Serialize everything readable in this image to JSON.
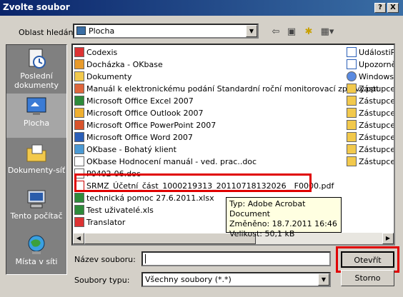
{
  "window": {
    "title": "Zvolte soubor",
    "help_label": "?",
    "close_label": "X"
  },
  "lookin": {
    "label": "Oblast hledání:",
    "value": "Plocha"
  },
  "toolbar_icons": [
    "back-icon",
    "up-folder-icon",
    "new-folder-icon",
    "view-menu-icon"
  ],
  "places": [
    {
      "label": "Poslední dokumenty",
      "icon": "recent-documents-icon"
    },
    {
      "label": "Plocha",
      "icon": "desktop-icon"
    },
    {
      "label": "Dokumenty-síť",
      "icon": "documents-network-icon"
    },
    {
      "label": "Tento počítač",
      "icon": "my-computer-icon"
    },
    {
      "label": "Místa v síti",
      "icon": "network-places-icon"
    }
  ],
  "files_col1": [
    {
      "name": "Codexis",
      "icon": "shortcut-icon"
    },
    {
      "name": "Docházka - OKbase",
      "icon": "web-shortcut-icon"
    },
    {
      "name": "Dokumenty",
      "icon": "folder-icon"
    },
    {
      "name": "Manuál k elektronickému podání Standardní roční monitorovací zprávy.ppt",
      "icon": "ppt-icon"
    },
    {
      "name": "Microsoft Office Excel 2007",
      "icon": "excel-icon"
    },
    {
      "name": "Microsoft Office Outlook 2007",
      "icon": "outlook-icon"
    },
    {
      "name": "Microsoft Office PowerPoint 2007",
      "icon": "powerpoint-icon"
    },
    {
      "name": "Microsoft Office Word 2007",
      "icon": "word-icon"
    },
    {
      "name": "OKbase - Bohatý klient",
      "icon": "app-icon"
    },
    {
      "name": "OKbase Hodnocení manuál - ved. prac..doc",
      "icon": "doc-icon"
    },
    {
      "name": "P0402-06.doc",
      "icon": "doc-icon"
    },
    {
      "name": "SRMZ_Účetní_část_1000219313_20110718132026__F0000.pdf",
      "icon": "pdf-icon"
    },
    {
      "name": "technická pomoc 27.6.2011.xlsx",
      "icon": "xlsx-icon"
    },
    {
      "name": "Test uživatelé.xls",
      "icon": "xls-icon"
    },
    {
      "name": "Translator",
      "icon": "app-icon"
    }
  ],
  "files_col2": [
    {
      "name": "UdálostiPr",
      "icon": "doc-icon"
    },
    {
      "name": "Upozorně",
      "icon": "doc-icon"
    },
    {
      "name": "Windows M",
      "icon": "windows-media-icon"
    },
    {
      "name": "Zástupce -",
      "icon": "folder-shortcut-icon"
    },
    {
      "name": "Zástupce -",
      "icon": "folder-shortcut-icon"
    },
    {
      "name": "Zástupce -",
      "icon": "folder-shortcut-icon"
    },
    {
      "name": "Zástupce -",
      "icon": "folder-shortcut-icon"
    },
    {
      "name": "Zástupce -",
      "icon": "folder-shortcut-icon"
    },
    {
      "name": "Zástupce -",
      "icon": "folder-shortcut-icon"
    },
    {
      "name": "Zástupce -",
      "icon": "folder-shortcut-icon"
    }
  ],
  "tooltip": {
    "type": "Typ: Adobe Acrobat Document",
    "modified": "Změněno: 18.7.2011 16:46",
    "size": "Velikost: 50,1 kB"
  },
  "filename": {
    "label": "Název souboru:",
    "value": ""
  },
  "filetype": {
    "label": "Soubory typu:",
    "value": "Všechny soubory (*.*)"
  },
  "buttons": {
    "open": "Otevřít",
    "cancel": "Storno"
  },
  "colors": {
    "highlight": "#e00000",
    "titlebar": "#0a246a",
    "tooltip_bg": "#ffffe1"
  }
}
